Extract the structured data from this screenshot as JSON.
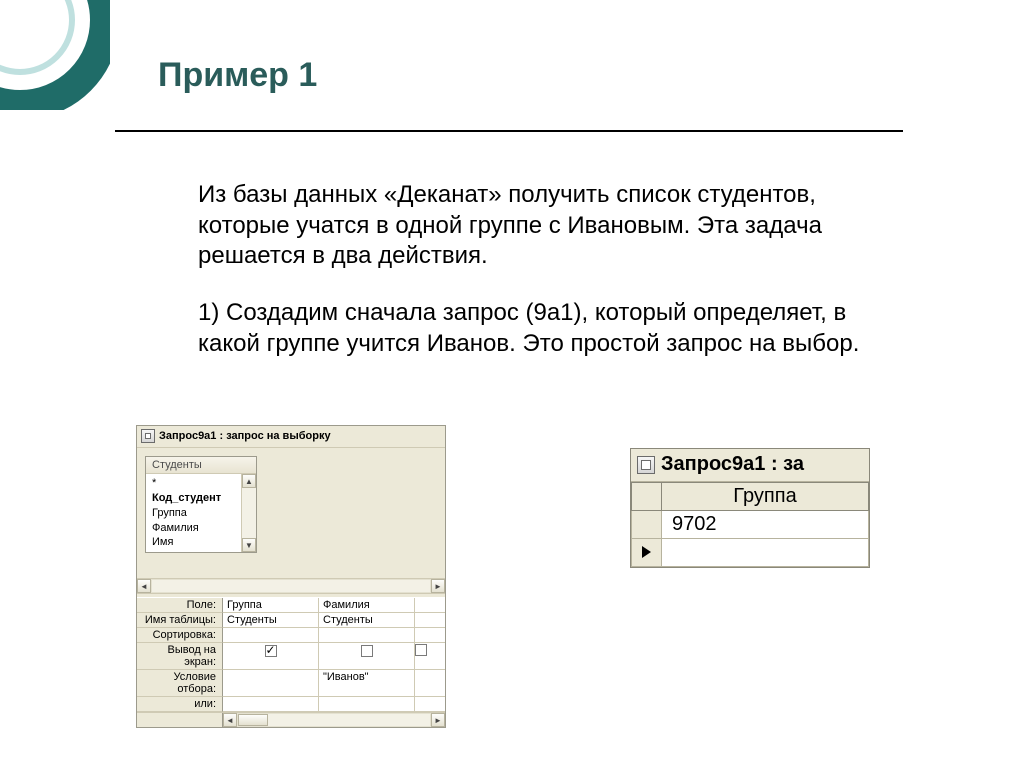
{
  "slide": {
    "title": "Пример 1",
    "p1": "Из базы данных  «Деканат» получить список студентов, которые учатся в одной группе с Ивановым. Эта задача решается в два действия.",
    "p2": "1) Создадим сначала запрос (9а1), который определяет, в какой группе учится Иванов. Это простой запрос на выбор."
  },
  "query_designer": {
    "title": "Запрос9а1 : запрос на выборку",
    "table": {
      "name": "Студенты",
      "fields": [
        "*",
        "Код_студент",
        "Группа",
        "Фамилия",
        "Имя"
      ]
    },
    "grid_labels": {
      "field": "Поле:",
      "table": "Имя таблицы:",
      "sort": "Сортировка:",
      "show": "Вывод на экран:",
      "criteria": "Условие отбора:",
      "or": "или:"
    },
    "columns": [
      {
        "field": "Группа",
        "table": "Студенты",
        "sort": "",
        "show": true,
        "criteria": ""
      },
      {
        "field": "Фамилия",
        "table": "Студенты",
        "sort": "",
        "show": false,
        "criteria": "\"Иванов\""
      }
    ]
  },
  "result": {
    "title": "Запрос9а1 : за",
    "header": "Группа",
    "value": "9702"
  }
}
